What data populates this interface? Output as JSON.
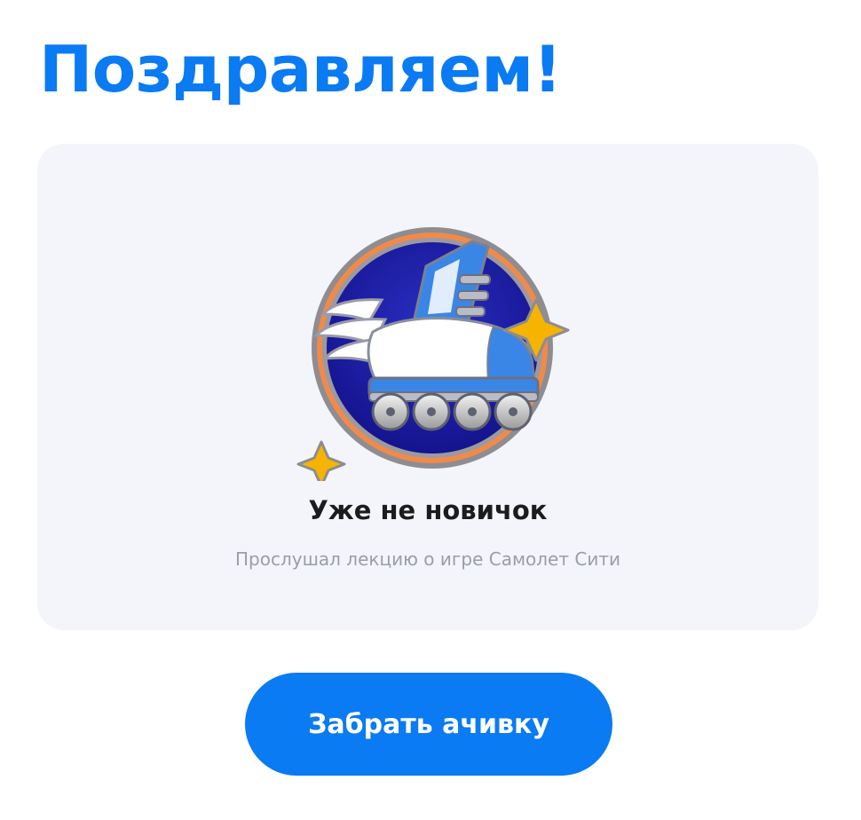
{
  "header": {
    "title": "Поздравляем!"
  },
  "achievement": {
    "icon": "rollerblade-badge-icon",
    "title": "Уже не новичок",
    "description": "Прослушал лекцию о игре Самолет Сити"
  },
  "actions": {
    "claim_label": "Забрать ачивку"
  },
  "colors": {
    "accent": "#0a7bf2",
    "card_background": "#f3f5fb",
    "badge_ring": "#f08a4b",
    "badge_inner": "#1a1aa6",
    "star": "#f6b400"
  }
}
